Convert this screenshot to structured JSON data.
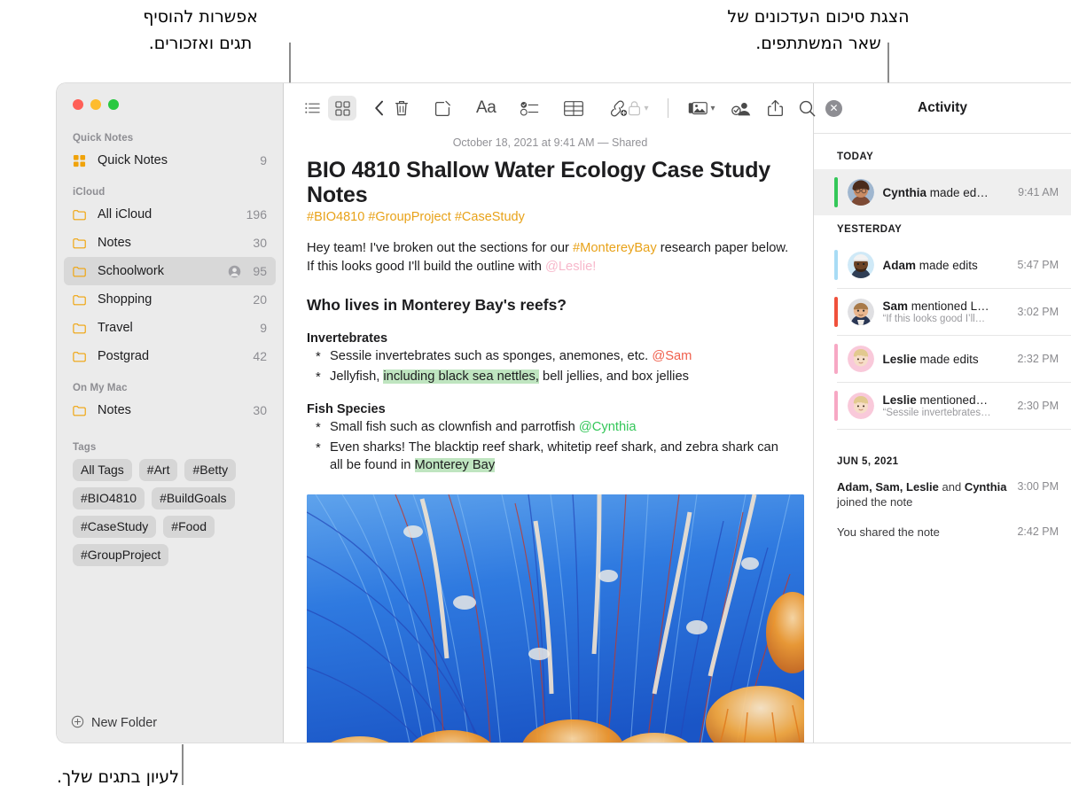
{
  "annotations": [
    {
      "id": "tags-mentions",
      "text": "אפשרות להוסיף\nתגים ואזכורים."
    },
    {
      "id": "activity-summary",
      "text": "הצגת סיכום העדכונים של\nשאר המשתתפים."
    },
    {
      "id": "browse-tags",
      "text": "לעיון בתגים שלך."
    }
  ],
  "window": {
    "traffic_lights": [
      "close",
      "minimize",
      "zoom"
    ]
  },
  "sidebar": {
    "sections": [
      {
        "label": "Quick Notes",
        "rows": [
          {
            "name": "Quick Notes",
            "count": "9",
            "icon": "quicknote-icon",
            "selected": false,
            "shared": false
          }
        ]
      },
      {
        "label": "iCloud",
        "rows": [
          {
            "name": "All iCloud",
            "count": "196",
            "icon": "folder-icon",
            "selected": false,
            "shared": false
          },
          {
            "name": "Notes",
            "count": "30",
            "icon": "folder-icon",
            "selected": false,
            "shared": false
          },
          {
            "name": "Schoolwork",
            "count": "95",
            "icon": "folder-icon",
            "selected": true,
            "shared": true
          },
          {
            "name": "Shopping",
            "count": "20",
            "icon": "folder-icon",
            "selected": false,
            "shared": false
          },
          {
            "name": "Travel",
            "count": "9",
            "icon": "folder-icon",
            "selected": false,
            "shared": false
          },
          {
            "name": "Postgrad",
            "count": "42",
            "icon": "folder-icon",
            "selected": false,
            "shared": false
          }
        ]
      },
      {
        "label": "On My Mac",
        "rows": [
          {
            "name": "Notes",
            "count": "30",
            "icon": "folder-icon",
            "selected": false,
            "shared": false
          }
        ]
      }
    ],
    "tags_label": "Tags",
    "tags": [
      "All Tags",
      "#Art",
      "#Betty",
      "#BIO4810",
      "#BuildGoals",
      "#CaseStudy",
      "#Food",
      "#GroupProject"
    ],
    "new_folder_label": "New Folder"
  },
  "toolbar": {
    "left": [
      {
        "icon": "list-view-icon",
        "active": false
      },
      {
        "icon": "gallery-view-icon",
        "active": true
      },
      {
        "icon": "back-chevron-icon",
        "active": false
      }
    ],
    "middle": [
      {
        "icon": "trash-icon"
      },
      {
        "icon": "compose-note-icon"
      },
      {
        "icon": "format-aa-icon",
        "label": "Aa"
      },
      {
        "icon": "checklist-icon"
      },
      {
        "icon": "table-icon"
      },
      {
        "icon": "add-link-icon"
      }
    ],
    "right": [
      {
        "icon": "lock-icon",
        "disabled": true,
        "has_chevron": true
      },
      {
        "icon": "media-icon",
        "disabled": false,
        "has_chevron": true
      },
      {
        "icon": "collaborate-icon",
        "disabled": false,
        "has_chevron": false
      },
      {
        "icon": "share-icon",
        "disabled": false,
        "has_chevron": false
      },
      {
        "icon": "search-icon",
        "disabled": false,
        "has_chevron": false
      }
    ]
  },
  "note": {
    "date": "October 18, 2021 at 9:41 AM — Shared",
    "title": "BIO 4810 Shallow Water Ecology Case Study Notes",
    "hashtags": "#BIO4810 #GroupProject #CaseStudy",
    "intro_1": "Hey team! I've broken out the sections for our ",
    "intro_tag": "#MontereyBay",
    "intro_2": " research paper below. If this looks good I'll build the outline with ",
    "intro_mention": "@Leslie!",
    "heading": "Who lives in Monterey Bay's reefs?",
    "sub1": "Invertebrates",
    "b1_text": "Sessile invertebrates such as sponges, anemones, etc. ",
    "b1_mention": "@Sam",
    "b2_a": "Jellyfish, ",
    "b2_hl": "including black sea nettles,",
    "b2_b": " bell jellies, and box jellies",
    "sub2": "Fish Species",
    "b3_text": "Small fish such as clownfish and parrotfish ",
    "b3_mention": "@Cynthia",
    "b4_a": "Even sharks! The blacktip reef shark, whitetip reef shark, and zebra shark can all be found in ",
    "b4_hl": "Monterey Bay",
    "image_alt": "jellyfish-photo"
  },
  "activity": {
    "title": "Activity",
    "close_icon": "close-icon",
    "groups": [
      {
        "day": "TODAY",
        "items": [
          {
            "actor": "Cynthia",
            "action": " made ed…",
            "quote": "",
            "time": "9:41 AM",
            "color": "#34c759",
            "avatar": "cynthia-avatar",
            "selected": true
          }
        ]
      },
      {
        "day": "YESTERDAY",
        "items": [
          {
            "actor": "Adam",
            "action": " made edits",
            "quote": "",
            "time": "5:47 PM",
            "color": "#a8dcf5",
            "avatar": "adam-avatar",
            "selected": false
          },
          {
            "actor": "Sam",
            "action": " mentioned L…",
            "quote": "“If this looks good I’ll…",
            "time": "3:02 PM",
            "color": "#f0513c",
            "avatar": "sam-avatar",
            "selected": false
          },
          {
            "actor": "Leslie",
            "action": " made edits",
            "quote": "",
            "time": "2:32 PM",
            "color": "#f7a8c4",
            "avatar": "leslie-avatar",
            "selected": false
          },
          {
            "actor": "Leslie",
            "action": " mentioned…",
            "quote": "“Sessile invertebrates…",
            "time": "2:30 PM",
            "color": "#f7a8c4",
            "avatar": "leslie-avatar",
            "selected": false
          }
        ]
      }
    ],
    "archive_day": "JUN 5, 2021",
    "archive": [
      {
        "names": "Adam, Sam, Leslie",
        "mid": " and ",
        "names2": "Cynthia",
        "tail": " joined the note",
        "time": "3:00 PM"
      },
      {
        "names": "",
        "mid": "",
        "names2": "",
        "tail": "You shared the note",
        "time": "2:42 PM"
      }
    ]
  }
}
